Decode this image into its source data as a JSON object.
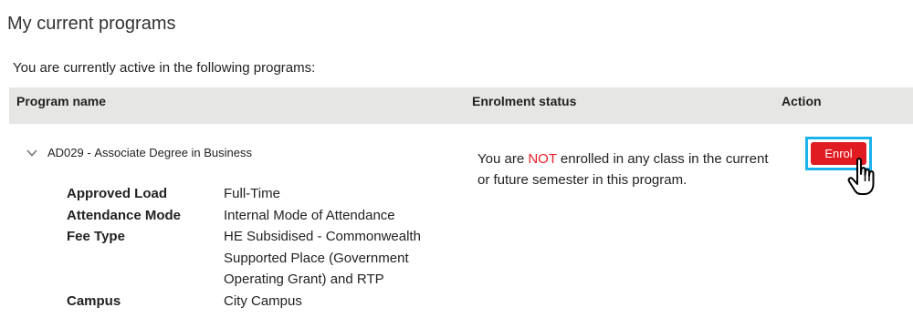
{
  "page": {
    "title": "My current programs",
    "intro": "You are currently active in the following programs:"
  },
  "table": {
    "headers": {
      "program_name": "Program name",
      "enrolment_status": "Enrolment status",
      "action": "Action"
    }
  },
  "program": {
    "code": "AD029",
    "separator": " - ",
    "name": "Associate Degree in Business",
    "expand_icon": "chevron-down-icon",
    "details": [
      {
        "label": "Approved Load",
        "value": "Full-Time"
      },
      {
        "label": "Attendance Mode",
        "value": "Internal Mode of Attendance"
      },
      {
        "label": "Fee Type",
        "value": "HE Subsidised - Commonwealth Supported Place (Government Operating Grant) and RTP"
      },
      {
        "label": "Campus",
        "value": "City Campus"
      }
    ],
    "status": {
      "prefix": "You are ",
      "emphasis": "NOT",
      "suffix": " enrolled in any class in the current or future semester in this program."
    },
    "action": {
      "label": "Enrol",
      "cursor_icon": "hand-pointer-icon"
    }
  },
  "colors": {
    "header_bg": "#e6e6e4",
    "enrol_button": "#e11b22",
    "highlight": "#1bb3ea",
    "not_text": "#e8202a"
  }
}
